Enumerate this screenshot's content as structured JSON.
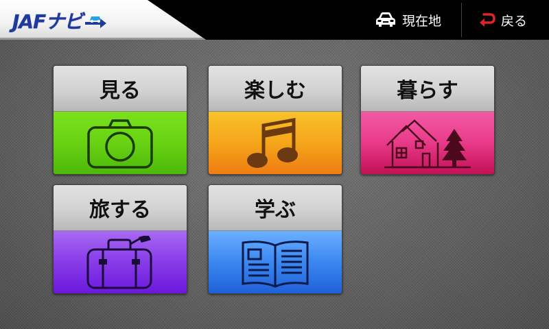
{
  "header": {
    "logo_text": "JAFナビ",
    "current_location_label": "現在地",
    "back_label": "戻る"
  },
  "menu": {
    "items": [
      {
        "label": "見る",
        "icon": "camera-icon",
        "color": "#6ad414"
      },
      {
        "label": "楽しむ",
        "icon": "music-note-icon",
        "color": "#f5a51a"
      },
      {
        "label": "暮らす",
        "icon": "house-icon",
        "color": "#ea3d8c"
      },
      {
        "label": "旅する",
        "icon": "suitcase-icon",
        "color": "#8a3fe9"
      },
      {
        "label": "学ぶ",
        "icon": "open-book-icon",
        "color": "#3a86f0"
      }
    ]
  },
  "colors": {
    "header_bg": "#000000",
    "logo_blue": "#1e3a9c",
    "back_arrow": "#e0242a"
  }
}
